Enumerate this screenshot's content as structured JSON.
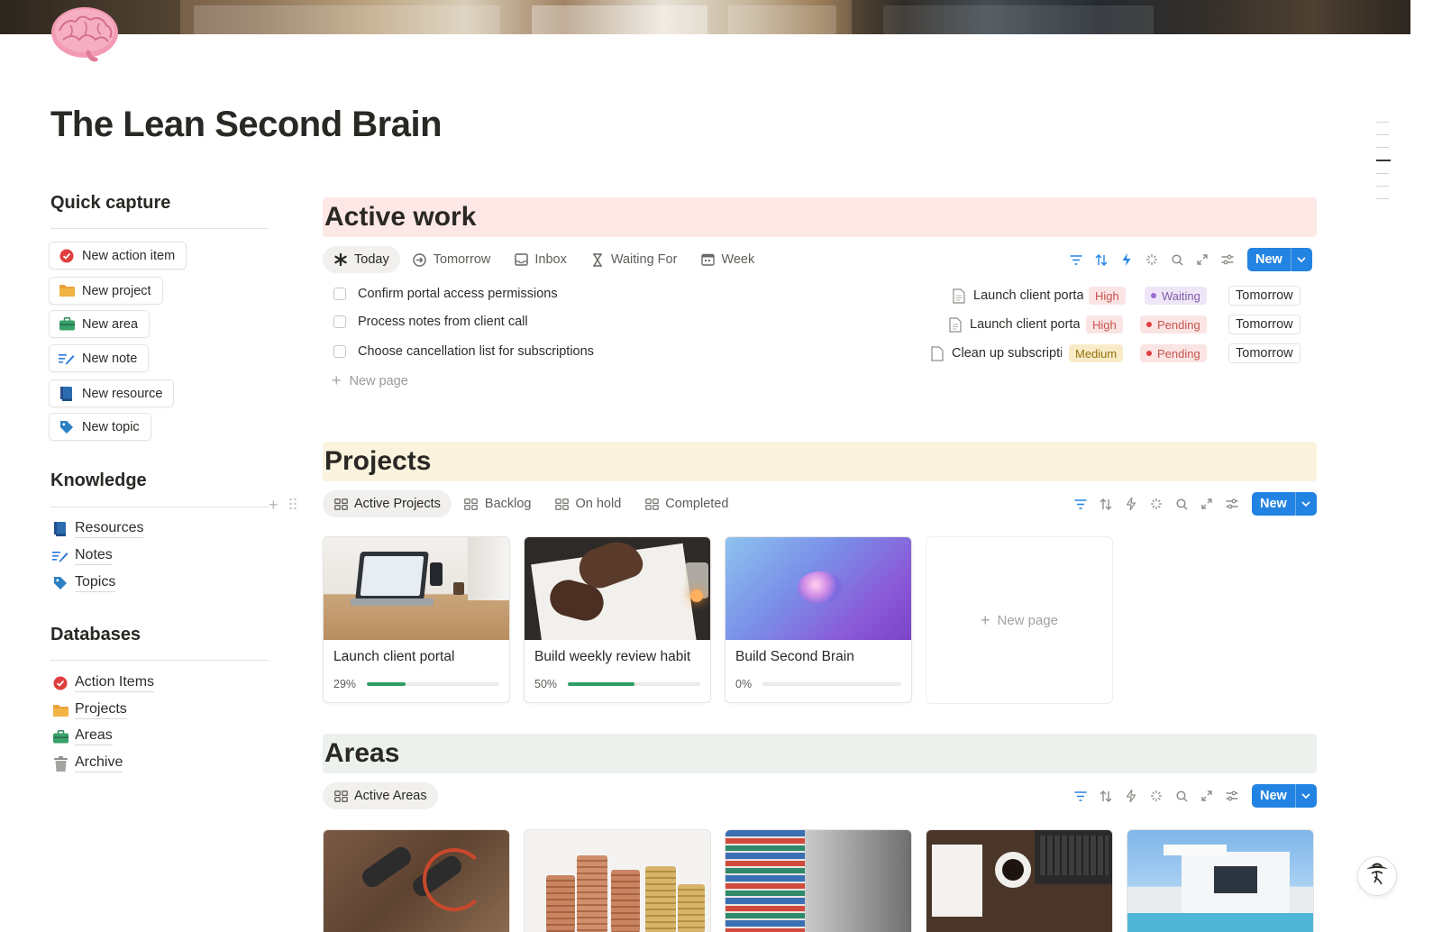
{
  "page": {
    "title": "The Lean Second Brain"
  },
  "sidebar": {
    "quick_capture": {
      "heading": "Quick capture",
      "buttons": [
        {
          "label": "New action item",
          "icon": "check-circle-icon"
        },
        {
          "label": "New project",
          "icon": "folder-icon"
        },
        {
          "label": "New area",
          "icon": "briefcase-icon"
        },
        {
          "label": "New note",
          "icon": "note-lines-icon"
        },
        {
          "label": "New resource",
          "icon": "book-icon"
        },
        {
          "label": "New topic",
          "icon": "tag-icon"
        }
      ]
    },
    "knowledge": {
      "heading": "Knowledge",
      "links": [
        {
          "label": "Resources",
          "icon": "book-icon"
        },
        {
          "label": "Notes",
          "icon": "note-lines-icon"
        },
        {
          "label": "Topics",
          "icon": "tag-icon"
        }
      ]
    },
    "databases": {
      "heading": "Databases",
      "links": [
        {
          "label": "Action Items",
          "icon": "check-circle-icon"
        },
        {
          "label": "Projects",
          "icon": "folder-icon"
        },
        {
          "label": "Areas",
          "icon": "briefcase-icon"
        },
        {
          "label": "Archive",
          "icon": "trash-icon"
        }
      ]
    }
  },
  "active_work": {
    "title": "Active work",
    "tabs": [
      {
        "label": "Today",
        "icon": "asterisk-icon"
      },
      {
        "label": "Tomorrow",
        "icon": "arrow-circle-icon"
      },
      {
        "label": "Inbox",
        "icon": "inbox-icon"
      },
      {
        "label": "Waiting For",
        "icon": "hourglass-icon"
      },
      {
        "label": "Week",
        "icon": "calendar-icon"
      }
    ],
    "new_label": "New",
    "tasks": [
      "Confirm portal access permissions",
      "Process notes from client call",
      "Choose cancellation list for subscriptions"
    ],
    "new_page_label": "New page",
    "linked": [
      {
        "name": "Launch client portal",
        "priority": "High",
        "status": "Waiting",
        "date": "Tomorrow"
      },
      {
        "name": "Launch client portal",
        "priority": "High",
        "status": "Pending",
        "date": "Tomorrow"
      },
      {
        "name": "Clean up subscriptions",
        "priority": "Medium",
        "status": "Pending",
        "date": "Tomorrow"
      }
    ]
  },
  "projects": {
    "title": "Projects",
    "tabs": [
      {
        "label": "Active Projects",
        "icon": "gallery-icon"
      },
      {
        "label": "Backlog",
        "icon": "gallery-icon"
      },
      {
        "label": "On hold",
        "icon": "gallery-icon"
      },
      {
        "label": "Completed",
        "icon": "gallery-icon"
      }
    ],
    "new_label": "New",
    "cards": [
      {
        "title": "Launch client portal",
        "progress_label": "29%",
        "progress": 0.29
      },
      {
        "title": "Build weekly review habit",
        "progress_label": "50%",
        "progress": 0.5
      },
      {
        "title": "Build Second Brain",
        "progress_label": "0%",
        "progress": 0
      }
    ],
    "new_page_label": "New page"
  },
  "areas": {
    "title": "Areas",
    "tabs": [
      {
        "label": "Active Areas",
        "icon": "gallery-icon"
      }
    ],
    "new_label": "New"
  },
  "colors": {
    "accent": "#2383e2",
    "active_work_bg": "#fde8e6",
    "projects_bg": "#fbf3de",
    "areas_bg": "#ecf1ee",
    "progress": "#2e9d64"
  }
}
